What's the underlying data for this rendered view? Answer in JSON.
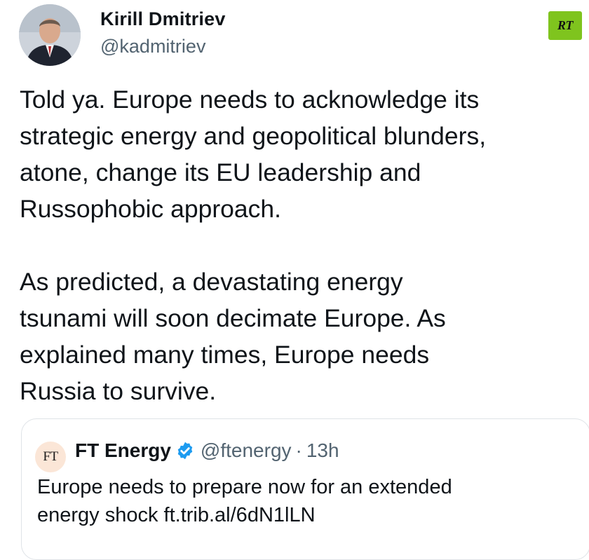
{
  "tweet": {
    "author_name": "Kirill Dmitriev",
    "author_handle": "@kadmitriev",
    "paragraph_1": "Told ya. Europe needs to acknowledge its\nstrategic energy and geopolitical blunders,\natone, change its EU leadership and\nRussophobic approach.",
    "paragraph_2": "As predicted, a devastating energy\ntsunami will soon decimate Europe. As\nexplained many times, Europe needs\nRussia to survive."
  },
  "watermark": {
    "label": "RT",
    "color": "#7fc41e"
  },
  "quoted_tweet": {
    "logo_text": "FT",
    "name": "FT Energy",
    "verified_icon": "verified-badge-icon",
    "handle": "@ftenergy",
    "separator": "·",
    "time": "13h",
    "text": "Europe needs to prepare now for an extended\nenergy shock ft.trib.al/6dN1lLN"
  },
  "colors": {
    "verified_blue": "#1d9bf0",
    "secondary_text": "#536471"
  }
}
